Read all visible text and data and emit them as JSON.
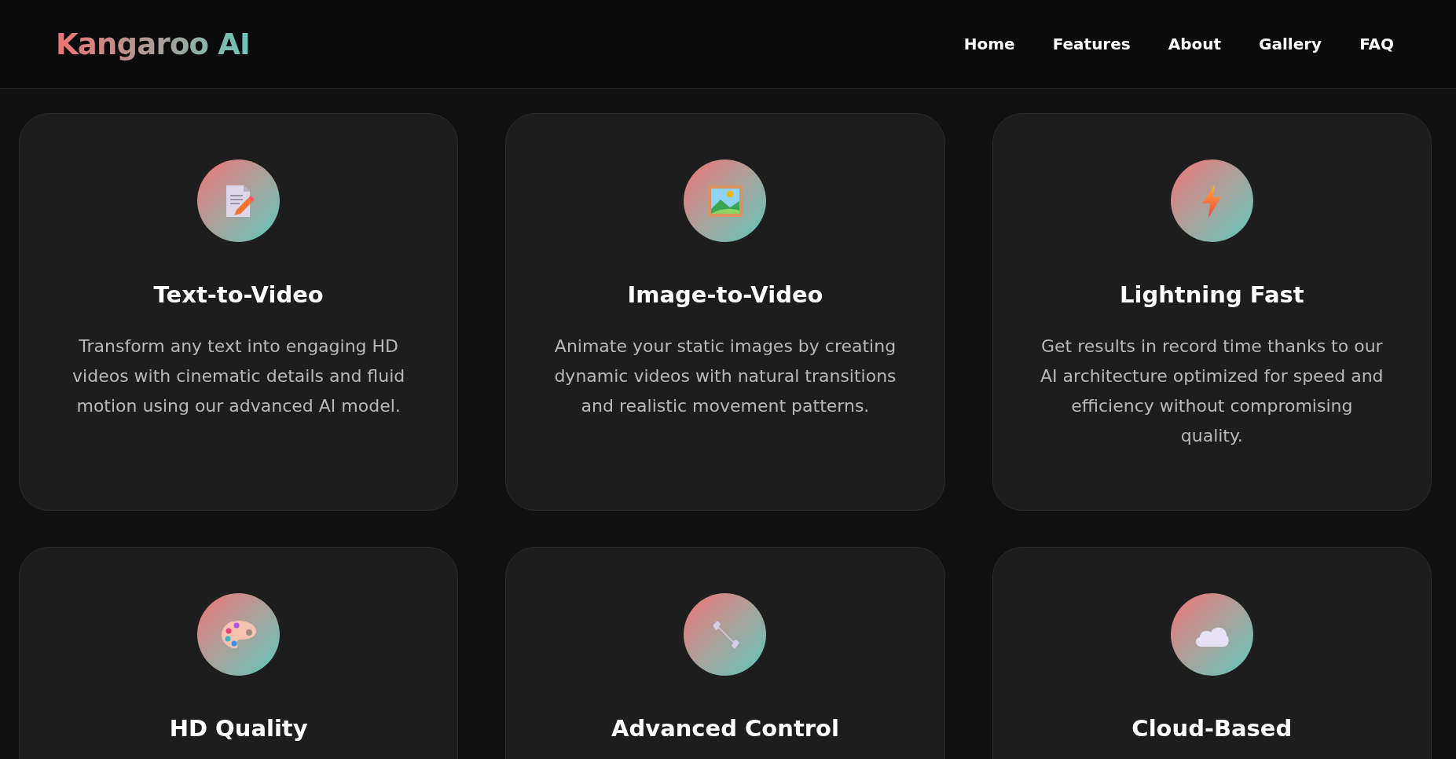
{
  "header": {
    "logo": "Kangaroo AI",
    "nav": [
      "Home",
      "Features",
      "About",
      "Gallery",
      "FAQ"
    ]
  },
  "features": [
    {
      "title": "Text-to-Video",
      "description": "Transform any text into engaging HD videos with cinematic details and fluid motion using our advanced AI model."
    },
    {
      "title": "Image-to-Video",
      "description": "Animate your static images by creating dynamic videos with natural transitions and realistic movement patterns."
    },
    {
      "title": "Lightning Fast",
      "description": "Get results in record time thanks to our AI architecture optimized for speed and efficiency without compromising quality."
    },
    {
      "title": "HD Quality"
    },
    {
      "title": "Advanced Control"
    },
    {
      "title": "Cloud-Based"
    }
  ]
}
